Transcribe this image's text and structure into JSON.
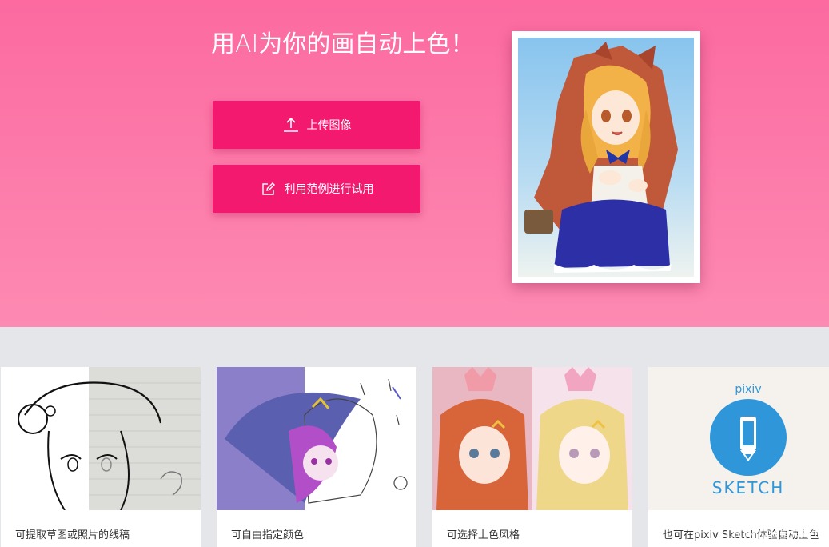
{
  "hero": {
    "title": "用AI为你的画自动上色！",
    "upload_label": "上传图像",
    "sample_label": "利用范例进行试用"
  },
  "cards": [
    {
      "caption": "可提取草图或照片的线稿"
    },
    {
      "caption": "可自由指定颜色"
    },
    {
      "caption": "可选择上色风格"
    },
    {
      "caption": "也可在pixiv Sketch体验自动上色",
      "logo_text": "pixiv",
      "brand_text": "SKETCH"
    }
  ],
  "watermark": "CSDN @我是朱先生",
  "icons": {
    "upload": "upload-icon",
    "edit": "edit-icon",
    "pencil": "pencil-icon"
  },
  "colors": {
    "hero_top": "#fc6aa0",
    "hero_bottom": "#fd8ab2",
    "button": "#f3196e",
    "sketch_blue": "#2e96d9"
  }
}
